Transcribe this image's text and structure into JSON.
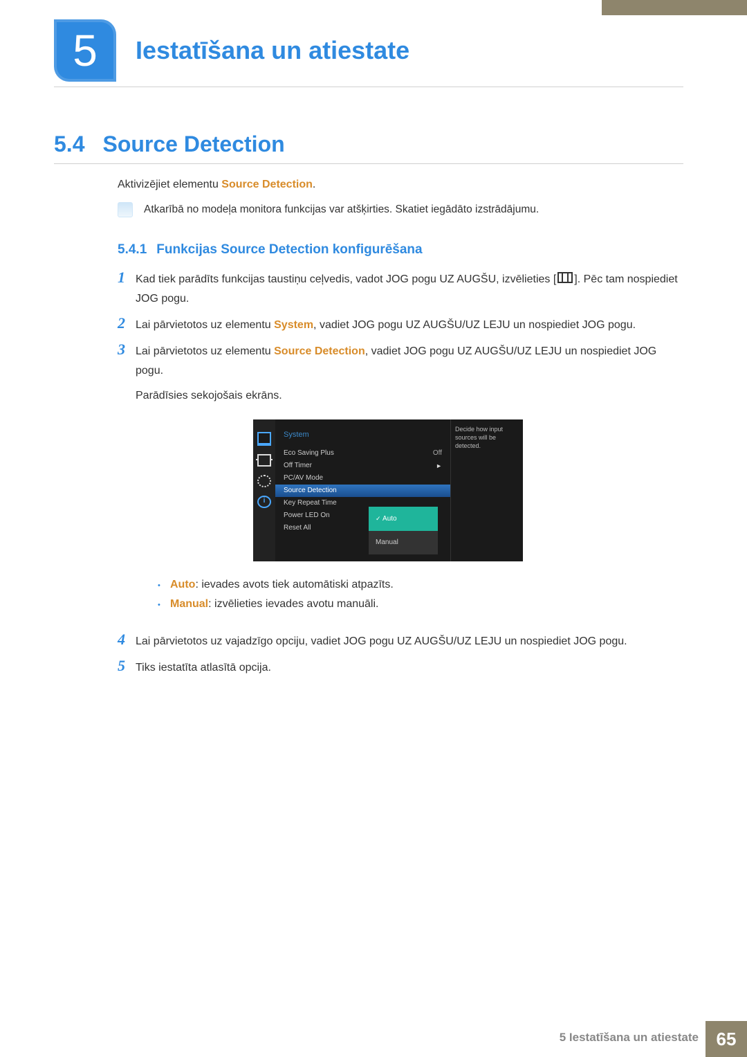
{
  "chapter": {
    "number": "5",
    "title": "Iestatīšana un atiestate"
  },
  "section": {
    "number": "5.4",
    "title": "Source Detection"
  },
  "intro": {
    "pre": "Aktivizējiet elementu ",
    "highlight": "Source Detection",
    "post": "."
  },
  "note": "Atkarībā no modeļa monitora funkcijas var atšķirties. Skatiet iegādāto izstrādājumu.",
  "subsection": {
    "number": "5.4.1",
    "title": "Funkcijas Source Detection konfigurēšana"
  },
  "steps": {
    "s1a": "Kad tiek parādīts funkcijas taustiņu ceļvedis, vadot JOG pogu UZ AUGŠU, izvēlieties [",
    "s1b": "]. Pēc tam nospiediet JOG pogu.",
    "s2a": "Lai pārvietotos uz elementu ",
    "s2h": "System",
    "s2b": ", vadiet JOG pogu UZ AUGŠU/UZ LEJU un nospiediet JOG pogu.",
    "s3a": "Lai pārvietotos uz elementu ",
    "s3h": "Source Detection",
    "s3b": ", vadiet JOG pogu UZ AUGŠU/UZ LEJU un nospiediet JOG pogu.",
    "s3c": "Parādīsies sekojošais ekrāns.",
    "s4": "Lai pārvietotos uz vajadzīgo opciju, vadiet JOG pogu UZ AUGŠU/UZ LEJU un nospiediet JOG pogu.",
    "s5": "Tiks iestatīta atlasītā opcija."
  },
  "bullets": {
    "b1h": "Auto",
    "b1t": ": ievades avots tiek automātiski atpazīts.",
    "b2h": "Manual",
    "b2t": ": izvēlieties ievades avotu manuāli."
  },
  "osd": {
    "title": "System",
    "rows": [
      {
        "label": "Eco Saving Plus",
        "value": "Off"
      },
      {
        "label": "Off Timer",
        "value": "►"
      },
      {
        "label": "PC/AV Mode",
        "value": ""
      },
      {
        "label": "Source Detection",
        "value": ""
      },
      {
        "label": "Key Repeat Time",
        "value": ""
      },
      {
        "label": "Power LED On",
        "value": ""
      },
      {
        "label": "Reset All",
        "value": ""
      }
    ],
    "options": {
      "auto": "Auto",
      "manual": "Manual"
    },
    "desc": "Decide how input sources will be detected."
  },
  "footer": {
    "text": "5 Iestatīšana un atiestate",
    "page": "65"
  },
  "nums": {
    "n1": "1",
    "n2": "2",
    "n3": "3",
    "n4": "4",
    "n5": "5"
  }
}
